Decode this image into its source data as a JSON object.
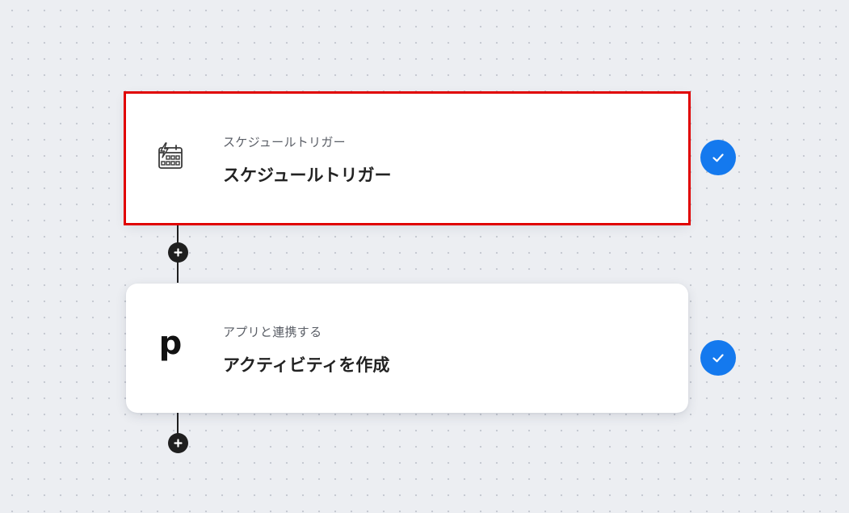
{
  "flow": {
    "steps": [
      {
        "subtitle": "スケジュールトリガー",
        "title": "スケジュールトリガー",
        "icon": "schedule-calendar-bolt-icon",
        "status": "completed",
        "selected": true
      },
      {
        "subtitle": "アプリと連携する",
        "title": "アクティビティを作成",
        "icon": "pipedrive-logo-icon",
        "icon_glyph": "p",
        "status": "completed",
        "selected": false
      }
    ]
  },
  "colors": {
    "selection_outline": "#e00000",
    "check_badge": "#1479ee",
    "connector": "#1f1f1f",
    "canvas_bg": "#eceef2"
  }
}
